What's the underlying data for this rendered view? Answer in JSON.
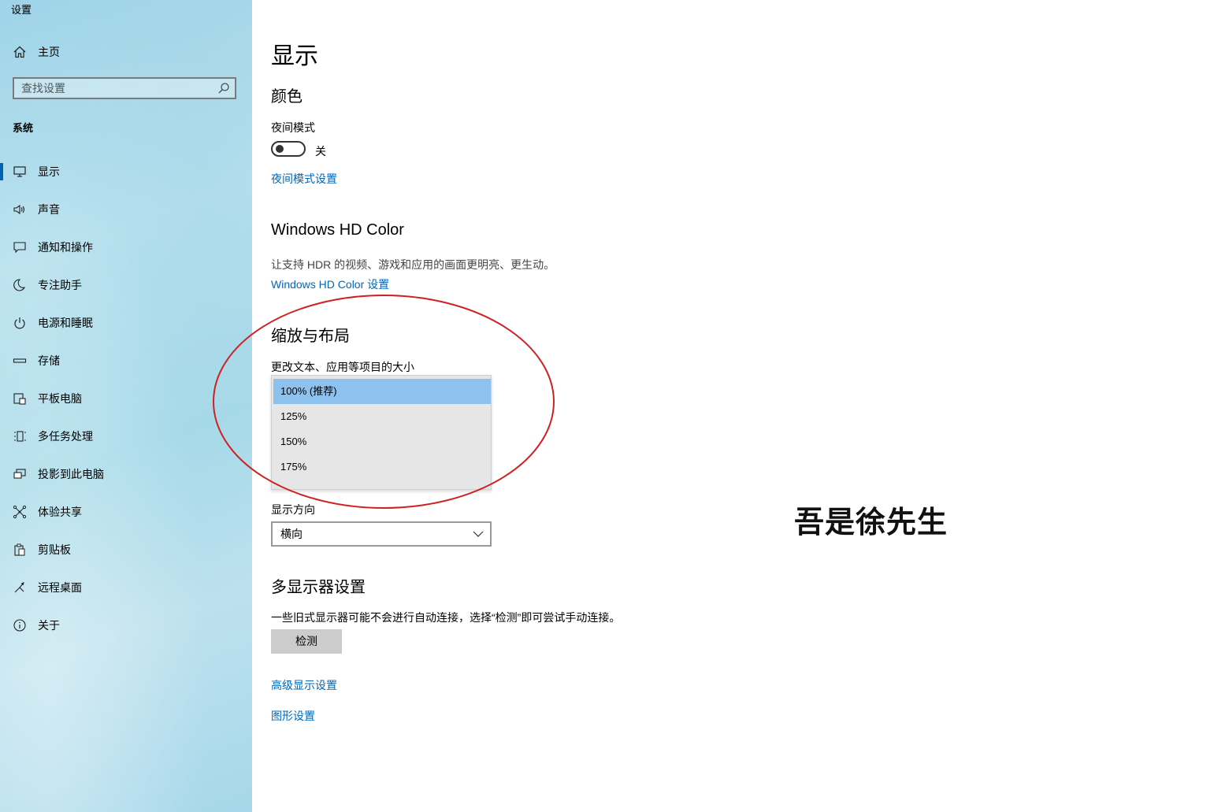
{
  "window": {
    "title": "设置"
  },
  "sidebar": {
    "home_label": "主页",
    "search_placeholder": "查找设置",
    "section_title": "系统",
    "items": [
      {
        "label": "显示",
        "icon": "monitor-icon",
        "active": true
      },
      {
        "label": "声音",
        "icon": "speaker-icon"
      },
      {
        "label": "通知和操作",
        "icon": "notification-icon"
      },
      {
        "label": "专注助手",
        "icon": "moon-icon"
      },
      {
        "label": "电源和睡眠",
        "icon": "power-icon"
      },
      {
        "label": "存储",
        "icon": "storage-icon"
      },
      {
        "label": "平板电脑",
        "icon": "tablet-icon"
      },
      {
        "label": "多任务处理",
        "icon": "multitask-icon"
      },
      {
        "label": "投影到此电脑",
        "icon": "project-icon"
      },
      {
        "label": "体验共享",
        "icon": "share-icon"
      },
      {
        "label": "剪贴板",
        "icon": "clipboard-icon"
      },
      {
        "label": "远程桌面",
        "icon": "remote-icon"
      },
      {
        "label": "关于",
        "icon": "info-icon"
      }
    ]
  },
  "main": {
    "title": "显示",
    "color": {
      "heading": "颜色",
      "night_mode_label": "夜间模式",
      "night_mode_state": "关",
      "night_mode_link": "夜间模式设置"
    },
    "hdr": {
      "heading": "Windows HD Color",
      "description": "让支持 HDR 的视频、游戏和应用的画面更明亮、更生动。",
      "link": "Windows HD Color 设置"
    },
    "scale": {
      "heading": "缩放与布局",
      "size_label": "更改文本、应用等项目的大小",
      "options": [
        "100% (推荐)",
        "125%",
        "150%",
        "175%"
      ],
      "selected_index": 0,
      "orientation_label": "显示方向",
      "orientation_value": "横向"
    },
    "multi": {
      "heading": "多显示器设置",
      "description": "一些旧式显示器可能不会进行自动连接，选择“检测”即可尝试手动连接。",
      "detect_button": "检测",
      "advanced_link": "高级显示设置",
      "graphics_link": "图形设置"
    }
  },
  "watermark": "吾是徐先生",
  "colors": {
    "accent": "#0063b1",
    "link": "#0067b8",
    "annotation": "#cc2222",
    "selected_option": "#8ec2ee"
  }
}
